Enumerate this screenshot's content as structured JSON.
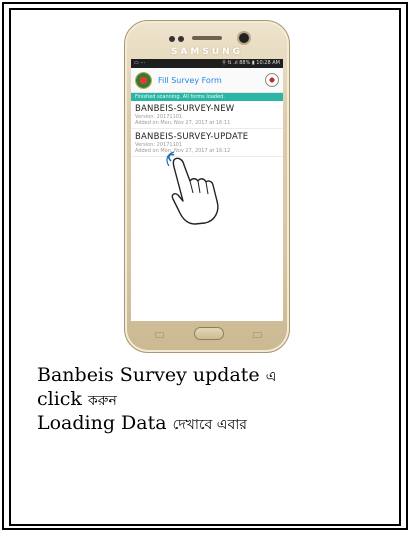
{
  "phone": {
    "brand": "SAMSUNG",
    "status_right": "⚲ ⇅ .ıl 88% ▮ 10:28 AM",
    "status_left": "▭ ⋯",
    "app_title": "Fill Survey Form",
    "info_banner": "Finished scanning. All forms loaded.",
    "forms": [
      {
        "name": "BANBEIS-SURVEY-NEW",
        "version": "Version: 20171101",
        "added": "Added on Mon, Nov 27, 2017 at 16:11"
      },
      {
        "name": "BANBEIS-SURVEY-UPDATE",
        "version": "Version: 20171101",
        "added": "Added on Mon, Nov 27, 2017 at 16:12"
      }
    ]
  },
  "caption": {
    "line1_en": "Banbeis Survey update",
    "line1_bn": "এ",
    "line2_en": "click",
    "line2_bn": "করুন",
    "line3_en": "Loading Data",
    "line3_bn": "দেখাবে এবার"
  },
  "colors": {
    "accent_teal": "#2ab5a5",
    "title_blue": "#1e88e5",
    "phone_gold": "#d6c6a2"
  },
  "icons": [
    "app-logo-icon",
    "govt-emblem-icon",
    "tapping-hand-icon"
  ]
}
